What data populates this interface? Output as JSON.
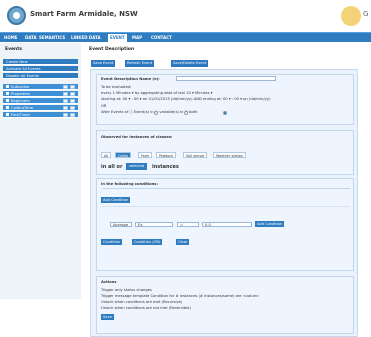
{
  "header": {
    "title": "Smart Farm Armidale, NSW",
    "right_text": "G"
  },
  "nav": [
    "HOME",
    "DATA",
    "SEMANTICS",
    "LINKED DATA",
    "EVENT",
    "MAP",
    "CONTACT"
  ],
  "sidebar": {
    "heading": "Events",
    "items": [
      "Create New",
      "Activate All Events",
      "Disable All Events"
    ],
    "events": [
      "Subscribe",
      "Properties",
      "Beginners",
      "CalibraTime",
      "FlexiTimer"
    ]
  },
  "main": {
    "heading": "Event Description",
    "tabs": [
      "Save Event",
      "Refresh Event",
      "Save/Delete Event"
    ],
    "event_name_label": "Event Description Name (e):",
    "schedule": {
      "heading": "To be evaluated:",
      "lines": [
        "every 1 Minutes ▾ by aggregating data of last 10 ▾ Minutes ▾",
        "starting at: 00 ▾ : 00 ▾ on 01/01/2015 (dd/mm/yy) AND ending at: 00 ▾ : 00 ▾ on (dd/mm/yy)",
        "OR",
        "After        Events of  ○ Event(s) in  ○ variable(s) in  ● both"
      ]
    },
    "observed": {
      "heading": "Observed for instances of classes:",
      "pills": [
        "All",
        "Cattle",
        "Farm",
        "Paddock",
        "Soil sensor",
        "Weather station"
      ],
      "selected": "Cattle"
    },
    "instances_text": [
      "in all or",
      "selected",
      "instances"
    ],
    "conditions": {
      "heading": "In the following conditions:",
      "add_button": "Add Condition",
      "row": [
        "Average",
        "Ex",
        "=",
        "0.0"
      ],
      "add_button2": "Add Condition",
      "buttons": [
        "Condition",
        "Condition (OR)",
        "Clear"
      ]
    },
    "actions": {
      "heading": "Actions",
      "lines": [
        "Trigger only status changes",
        "Trigger message template Condition for # instances (# instances/same) are <value>",
        "Unlock when conditions are met (Recursive)",
        "Unlock when conditions are not met (Reversible)"
      ],
      "save": "Save"
    }
  }
}
